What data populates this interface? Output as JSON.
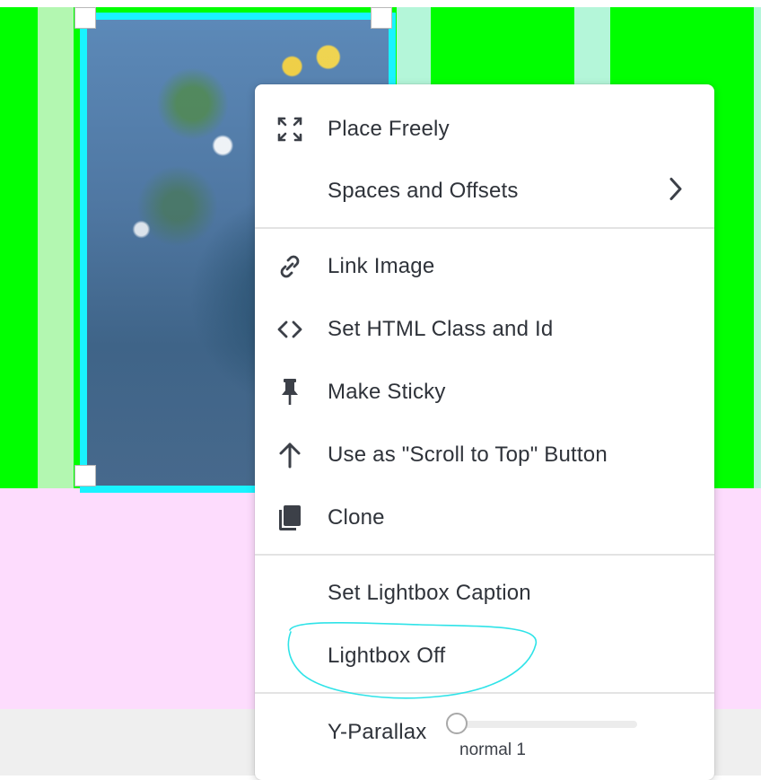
{
  "menu": {
    "items": [
      {
        "label": "Place Freely",
        "icon": "expand-arrows-icon"
      },
      {
        "label": "Spaces and Offsets",
        "icon": "none",
        "submenu": true
      },
      {
        "label": "Link Image",
        "icon": "link-icon"
      },
      {
        "label": "Set HTML Class and Id",
        "icon": "code-brackets-icon"
      },
      {
        "label": "Make Sticky",
        "icon": "pin-icon"
      },
      {
        "label": "Use as \"Scroll to Top\" Button",
        "icon": "arrow-up-icon"
      },
      {
        "label": "Clone",
        "icon": "clone-icon"
      },
      {
        "label": "Set Lightbox Caption",
        "icon": "none"
      },
      {
        "label": "Lightbox Off",
        "icon": "none"
      }
    ],
    "parallax": {
      "label": "Y-Parallax",
      "value_text": "normal 1",
      "level": 0
    }
  },
  "colors": {
    "selection_outline": "#19f3ff",
    "green_column": "#00ff00",
    "light_green_column": "#b3f7b1",
    "mint_column": "#b4f6d9",
    "pink_area": "#fddcfd",
    "annotation_circle": "#2fe3e8"
  }
}
